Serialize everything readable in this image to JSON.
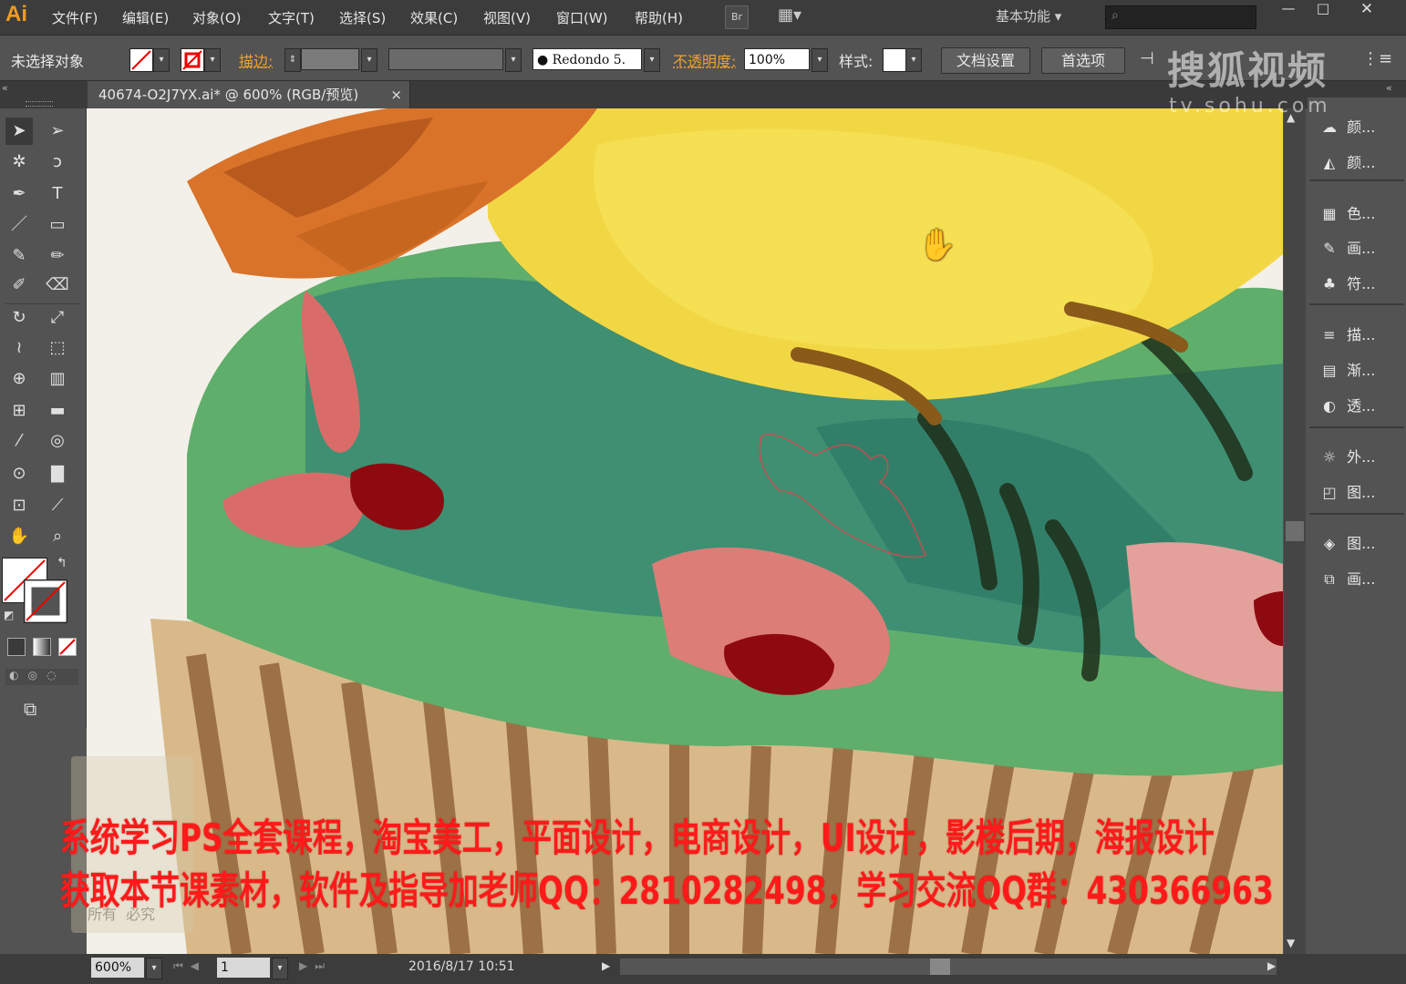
{
  "app": {
    "logo": "Ai",
    "workspace": "基本功能"
  },
  "menu": [
    "文件(F)",
    "编辑(E)",
    "对象(O)",
    "文字(T)",
    "选择(S)",
    "效果(C)",
    "视图(V)",
    "窗口(W)",
    "帮助(H)"
  ],
  "menubar_buttons": {
    "bridge": "Br"
  },
  "window_controls": {
    "minimize": "—",
    "maximize": "□",
    "close": "✕"
  },
  "control": {
    "selection_status": "未选择对象",
    "stroke_label": "描边:",
    "brush_value": "Redondo 5.",
    "opacity_label": "不透明度:",
    "opacity_value": "100%",
    "style_label": "样式:",
    "doc_setup": "文档设置",
    "preferences": "首选项"
  },
  "document_tab": {
    "title": "40674-O2J7YX.ai* @ 600% (RGB/预览)",
    "close": "×"
  },
  "right_panel": [
    {
      "icon": "color-palette-icon",
      "glyph": "☁",
      "label": "颜..."
    },
    {
      "icon": "color-guide-icon",
      "glyph": "◭",
      "label": "颜..."
    },
    {
      "icon": "swatches-icon",
      "glyph": "▦",
      "label": "色..."
    },
    {
      "icon": "brushes-icon",
      "glyph": "✎",
      "label": "画..."
    },
    {
      "icon": "symbols-icon",
      "glyph": "♣",
      "label": "符..."
    },
    {
      "icon": "stroke-icon",
      "glyph": "≡",
      "label": "描..."
    },
    {
      "icon": "gradient-icon",
      "glyph": "▤",
      "label": "渐..."
    },
    {
      "icon": "transparency-icon",
      "glyph": "◐",
      "label": "透..."
    },
    {
      "icon": "appearance-icon",
      "glyph": "☼",
      "label": "外..."
    },
    {
      "icon": "graphic-styles-icon",
      "glyph": "◰",
      "label": "图..."
    },
    {
      "icon": "layers-icon",
      "glyph": "◈",
      "label": "图..."
    },
    {
      "icon": "artboards-icon",
      "glyph": "⧉",
      "label": "画..."
    }
  ],
  "status": {
    "zoom": "600%",
    "page": "1",
    "datetime": "2016/8/17   10:51"
  },
  "overlay": {
    "sohu_logo": "搜狐视频",
    "sohu_url": "tv.sohu.com",
    "promo_line1": "系统学习PS全套课程，淘宝美工，平面设计，电商设计，UI设计，影楼后期，海报设计",
    "promo_line2": "获取本节课素材，软件及指导加老师QQ：2810282498，学习交流QQ群：430366963",
    "watermark_text": "所有  必究"
  }
}
